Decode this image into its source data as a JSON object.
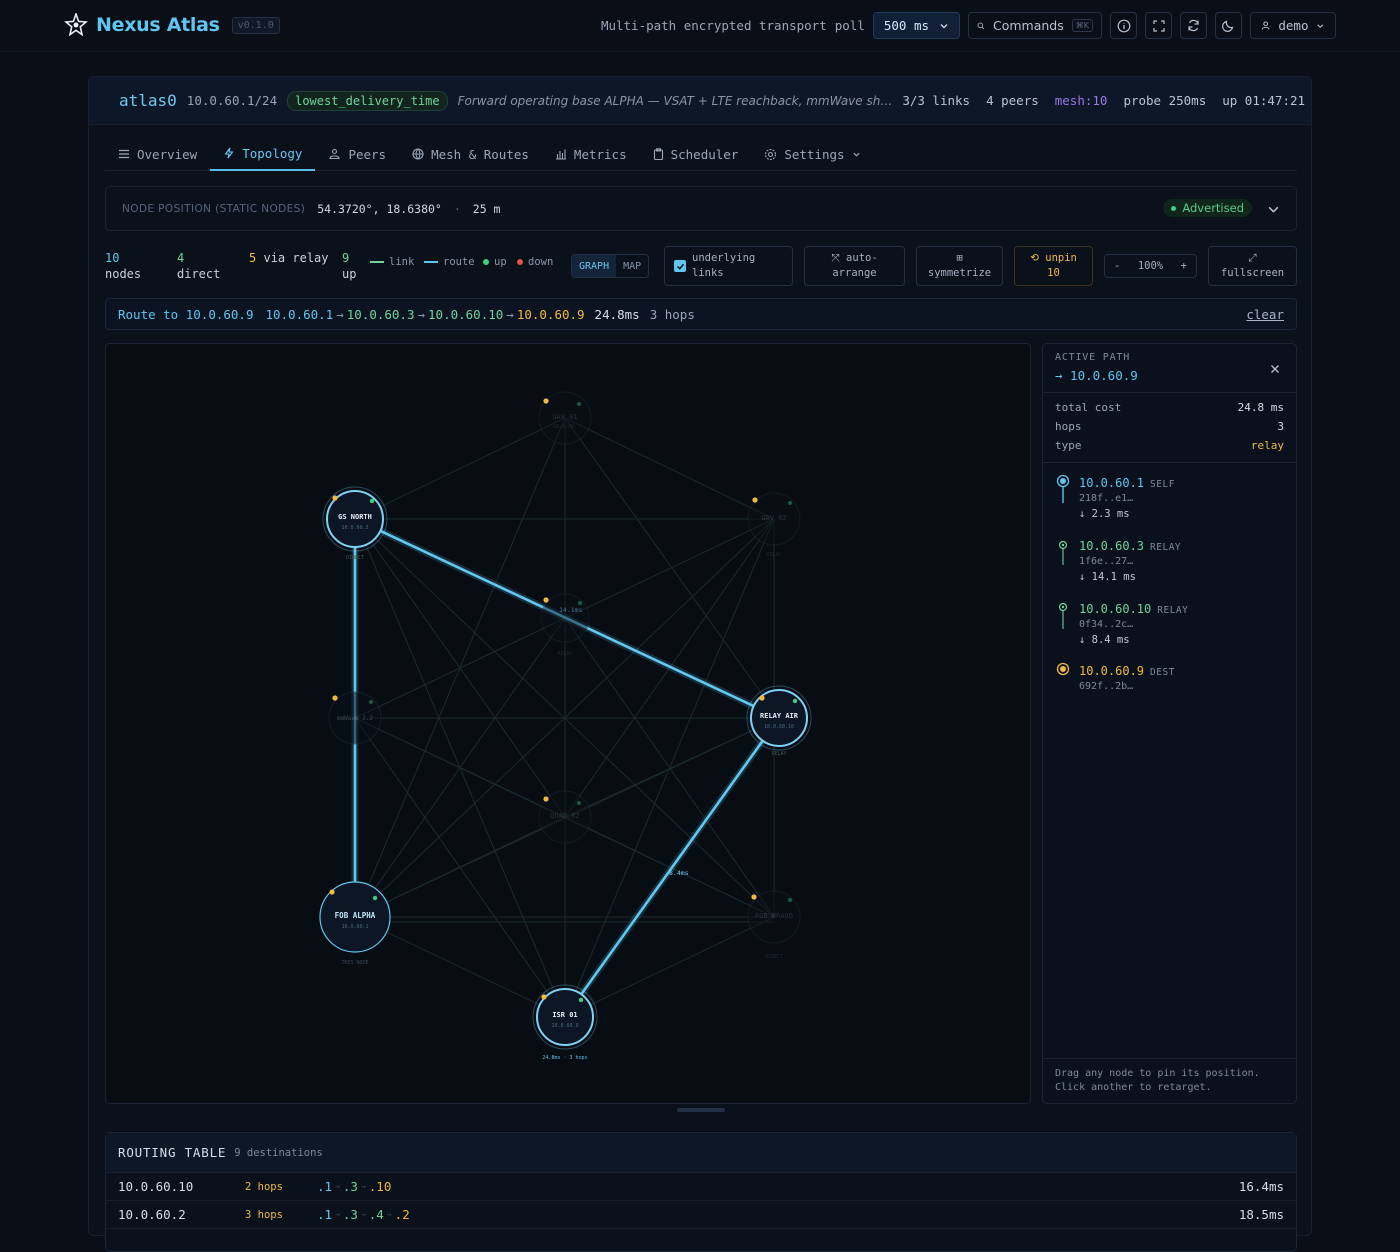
{
  "header": {
    "app_name": "Nexus Atlas",
    "version": "v0.1.0",
    "subtitle": "Multi-path encrypted transport",
    "poll_label": "poll",
    "poll_value": "500 ms",
    "commands_label": "Commands",
    "commands_kbd": "⌘K",
    "user": "demo"
  },
  "iface": {
    "name": "atlas0",
    "address": "10.0.60.1/24",
    "policy": "lowest_delivery_time",
    "description": "Forward operating base ALPHA — VSAT + LTE reachback, mmWave sh…",
    "links": "3/3 links",
    "peers": "4 peers",
    "mesh": "mesh:10",
    "probe": "probe 250ms",
    "uptime": "up 01:47:21"
  },
  "tabs": [
    {
      "label": "Overview",
      "icon": "menu-icon"
    },
    {
      "label": "Topology",
      "icon": "bolt-icon"
    },
    {
      "label": "Peers",
      "icon": "peers-icon"
    },
    {
      "label": "Mesh & Routes",
      "icon": "globe-icon"
    },
    {
      "label": "Metrics",
      "icon": "chart-icon"
    },
    {
      "label": "Scheduler",
      "icon": "clipboard-icon"
    },
    {
      "label": "Settings",
      "icon": "gear-icon"
    }
  ],
  "node_position": {
    "label": "NODE POSITION (STATIC NODES)",
    "coords": "54.3720°, 18.6380°",
    "sep": "·",
    "alt": "25 m",
    "status": "Advertised"
  },
  "counts": {
    "nodes_n": "10",
    "nodes_l": "nodes",
    "direct_n": "4",
    "direct_l": "direct",
    "relay_n": "5",
    "relay_l": "via relay",
    "up_n": "9",
    "up_l": "up"
  },
  "legend": {
    "link": "link",
    "route": "route",
    "up": "up",
    "down": "down"
  },
  "view": {
    "graph": "GRAPH",
    "map": "MAP"
  },
  "buttons": {
    "underlying_1": "underlying",
    "underlying_2": "links",
    "auto_icon": "⤧ auto-",
    "auto_2": "arrange",
    "sym_icon": "⊞",
    "sym_2": "symmetrize",
    "unpin_1": "⟲ unpin",
    "unpin_2": "10",
    "zoom_minus": "-",
    "zoom": "100%",
    "zoom_plus": "+",
    "fs_icon": "⤢",
    "fs_2": "fullscreen"
  },
  "route": {
    "label": "Route to",
    "dest": "10.0.60.9",
    "hops": [
      "10.0.60.1",
      "10.0.60.3",
      "10.0.60.10",
      "10.0.60.9"
    ],
    "arrow": "→",
    "latency": "24.8ms",
    "hop_count": "3 hops",
    "clear": "clear"
  },
  "graph": {
    "nodes": [
      {
        "id": "uav01",
        "name": "UAV 01",
        "ip": "10.0.60.",
        "role": "",
        "state": "dim"
      },
      {
        "id": "gsnorth",
        "name": "GS NORTH",
        "ip": "10.0.60.3",
        "role": "DIRECT",
        "state": "route"
      },
      {
        "id": "uav02",
        "name": "UAV 02",
        "ip": "",
        "role": "RELAY",
        "state": "dim"
      },
      {
        "id": "center",
        "name": "",
        "ip": "",
        "role": "RELAY",
        "state": "dim"
      },
      {
        "id": "mm",
        "name": "mmWave 2.2",
        "ip": "",
        "role": "",
        "state": "dim"
      },
      {
        "id": "relayair",
        "name": "RELAY AIR",
        "ip": "10.0.60.10",
        "role": "RELAY",
        "state": "route"
      },
      {
        "id": "quad02",
        "name": "QUAD 02",
        "ip": "",
        "role": "",
        "state": "dim"
      },
      {
        "id": "fobalpha",
        "name": "FOB ALPHA",
        "ip": "10.0.60.1",
        "role": "THIS NODE",
        "state": "self"
      },
      {
        "id": "fobbravo",
        "name": "FOB BRAVO",
        "ip": "",
        "role": "DIRECT",
        "state": "dim"
      },
      {
        "id": "isr01",
        "name": "ISR 01",
        "ip": "10.0.60.9",
        "role": "24.8ms · 3 hops",
        "state": "route"
      }
    ],
    "edge_labels": {
      "e1": "14.1ms",
      "e2": "8.4ms"
    }
  },
  "active_path": {
    "title": "ACTIVE PATH",
    "dest": "→ 10.0.60.9",
    "rows": [
      {
        "k": "total cost",
        "v": "24.8 ms"
      },
      {
        "k": "hops",
        "v": "3"
      },
      {
        "k": "type",
        "v": "relay"
      }
    ],
    "hops": [
      {
        "ip": "10.0.60.1",
        "tag": "SELF",
        "key": "218f..e1…",
        "lat": "↓ 2.3 ms"
      },
      {
        "ip": "10.0.60.3",
        "tag": "RELAY",
        "key": "1f6e..27…",
        "lat": "↓ 14.1 ms"
      },
      {
        "ip": "10.0.60.10",
        "tag": "RELAY",
        "key": "0f34..2c…",
        "lat": "↓ 8.4 ms"
      },
      {
        "ip": "10.0.60.9",
        "tag": "DEST",
        "key": "692f..2b…",
        "lat": ""
      }
    ],
    "hint": "Drag any node to pin its position. Click another to retarget."
  },
  "routing": {
    "title": "ROUTING TABLE",
    "count": "9 destinations",
    "rows": [
      {
        "dest": "10.0.60.10",
        "hops": "2 hops",
        "path": [
          ".1",
          ".3",
          ".10"
        ],
        "lat": "16.4ms"
      },
      {
        "dest": "10.0.60.2",
        "hops": "3 hops",
        "path": [
          ".1",
          ".3",
          ".4",
          ".2"
        ],
        "lat": "18.5ms"
      }
    ]
  },
  "colors": {
    "accent": "#5fc6ef",
    "route": "#4fb9ea",
    "relay": "#6fd39c",
    "dest": "#f2b942",
    "up": "#3fd07f",
    "down": "#e0584c"
  }
}
